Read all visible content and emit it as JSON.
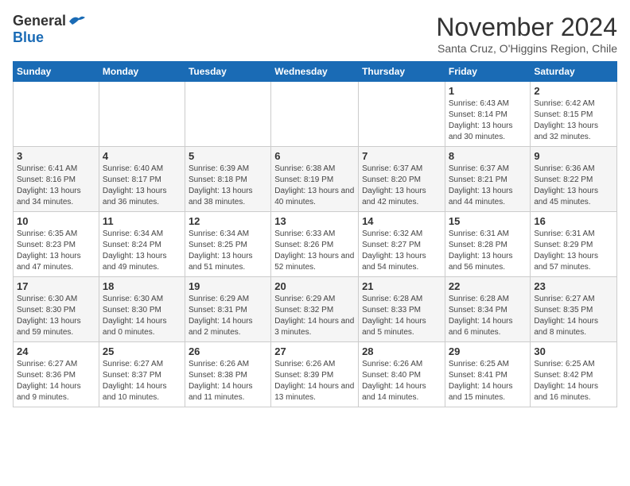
{
  "header": {
    "logo_general": "General",
    "logo_blue": "Blue",
    "month_year": "November 2024",
    "location": "Santa Cruz, O'Higgins Region, Chile"
  },
  "weekdays": [
    "Sunday",
    "Monday",
    "Tuesday",
    "Wednesday",
    "Thursday",
    "Friday",
    "Saturday"
  ],
  "weeks": [
    [
      {
        "day": "",
        "info": ""
      },
      {
        "day": "",
        "info": ""
      },
      {
        "day": "",
        "info": ""
      },
      {
        "day": "",
        "info": ""
      },
      {
        "day": "",
        "info": ""
      },
      {
        "day": "1",
        "info": "Sunrise: 6:43 AM\nSunset: 8:14 PM\nDaylight: 13 hours and 30 minutes."
      },
      {
        "day": "2",
        "info": "Sunrise: 6:42 AM\nSunset: 8:15 PM\nDaylight: 13 hours and 32 minutes."
      }
    ],
    [
      {
        "day": "3",
        "info": "Sunrise: 6:41 AM\nSunset: 8:16 PM\nDaylight: 13 hours and 34 minutes."
      },
      {
        "day": "4",
        "info": "Sunrise: 6:40 AM\nSunset: 8:17 PM\nDaylight: 13 hours and 36 minutes."
      },
      {
        "day": "5",
        "info": "Sunrise: 6:39 AM\nSunset: 8:18 PM\nDaylight: 13 hours and 38 minutes."
      },
      {
        "day": "6",
        "info": "Sunrise: 6:38 AM\nSunset: 8:19 PM\nDaylight: 13 hours and 40 minutes."
      },
      {
        "day": "7",
        "info": "Sunrise: 6:37 AM\nSunset: 8:20 PM\nDaylight: 13 hours and 42 minutes."
      },
      {
        "day": "8",
        "info": "Sunrise: 6:37 AM\nSunset: 8:21 PM\nDaylight: 13 hours and 44 minutes."
      },
      {
        "day": "9",
        "info": "Sunrise: 6:36 AM\nSunset: 8:22 PM\nDaylight: 13 hours and 45 minutes."
      }
    ],
    [
      {
        "day": "10",
        "info": "Sunrise: 6:35 AM\nSunset: 8:23 PM\nDaylight: 13 hours and 47 minutes."
      },
      {
        "day": "11",
        "info": "Sunrise: 6:34 AM\nSunset: 8:24 PM\nDaylight: 13 hours and 49 minutes."
      },
      {
        "day": "12",
        "info": "Sunrise: 6:34 AM\nSunset: 8:25 PM\nDaylight: 13 hours and 51 minutes."
      },
      {
        "day": "13",
        "info": "Sunrise: 6:33 AM\nSunset: 8:26 PM\nDaylight: 13 hours and 52 minutes."
      },
      {
        "day": "14",
        "info": "Sunrise: 6:32 AM\nSunset: 8:27 PM\nDaylight: 13 hours and 54 minutes."
      },
      {
        "day": "15",
        "info": "Sunrise: 6:31 AM\nSunset: 8:28 PM\nDaylight: 13 hours and 56 minutes."
      },
      {
        "day": "16",
        "info": "Sunrise: 6:31 AM\nSunset: 8:29 PM\nDaylight: 13 hours and 57 minutes."
      }
    ],
    [
      {
        "day": "17",
        "info": "Sunrise: 6:30 AM\nSunset: 8:30 PM\nDaylight: 13 hours and 59 minutes."
      },
      {
        "day": "18",
        "info": "Sunrise: 6:30 AM\nSunset: 8:30 PM\nDaylight: 14 hours and 0 minutes."
      },
      {
        "day": "19",
        "info": "Sunrise: 6:29 AM\nSunset: 8:31 PM\nDaylight: 14 hours and 2 minutes."
      },
      {
        "day": "20",
        "info": "Sunrise: 6:29 AM\nSunset: 8:32 PM\nDaylight: 14 hours and 3 minutes."
      },
      {
        "day": "21",
        "info": "Sunrise: 6:28 AM\nSunset: 8:33 PM\nDaylight: 14 hours and 5 minutes."
      },
      {
        "day": "22",
        "info": "Sunrise: 6:28 AM\nSunset: 8:34 PM\nDaylight: 14 hours and 6 minutes."
      },
      {
        "day": "23",
        "info": "Sunrise: 6:27 AM\nSunset: 8:35 PM\nDaylight: 14 hours and 8 minutes."
      }
    ],
    [
      {
        "day": "24",
        "info": "Sunrise: 6:27 AM\nSunset: 8:36 PM\nDaylight: 14 hours and 9 minutes."
      },
      {
        "day": "25",
        "info": "Sunrise: 6:27 AM\nSunset: 8:37 PM\nDaylight: 14 hours and 10 minutes."
      },
      {
        "day": "26",
        "info": "Sunrise: 6:26 AM\nSunset: 8:38 PM\nDaylight: 14 hours and 11 minutes."
      },
      {
        "day": "27",
        "info": "Sunrise: 6:26 AM\nSunset: 8:39 PM\nDaylight: 14 hours and 13 minutes."
      },
      {
        "day": "28",
        "info": "Sunrise: 6:26 AM\nSunset: 8:40 PM\nDaylight: 14 hours and 14 minutes."
      },
      {
        "day": "29",
        "info": "Sunrise: 6:25 AM\nSunset: 8:41 PM\nDaylight: 14 hours and 15 minutes."
      },
      {
        "day": "30",
        "info": "Sunrise: 6:25 AM\nSunset: 8:42 PM\nDaylight: 14 hours and 16 minutes."
      }
    ]
  ]
}
